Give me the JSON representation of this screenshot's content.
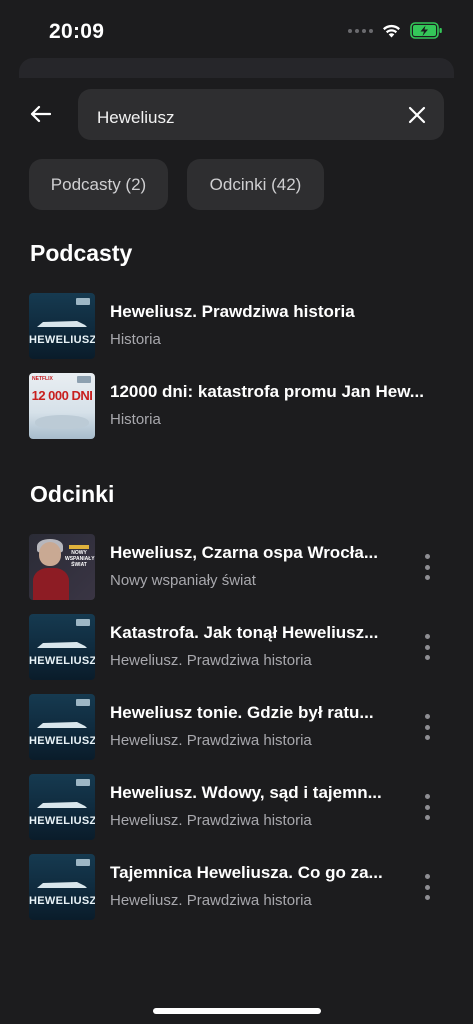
{
  "status_bar": {
    "time": "20:09"
  },
  "search": {
    "query": "Heweliusz"
  },
  "filters": {
    "podcasts_label": "Podcasty (2)",
    "episodes_label": "Odcinki (42)"
  },
  "sections": {
    "podcasts_title": "Podcasty",
    "episodes_title": "Odcinki"
  },
  "podcasts": [
    {
      "title": "Heweliusz. Prawdziwa historia",
      "category": "Historia"
    },
    {
      "title": "12000 dni: katastrofa promu Jan Hew...",
      "category": "Historia"
    }
  ],
  "episodes": [
    {
      "title": "Heweliusz, Czarna ospa Wrocła...",
      "podcast": "Nowy wspaniały świat"
    },
    {
      "title": "Katastrofa. Jak tonął Heweliusz...",
      "podcast": "Heweliusz. Prawdziwa historia"
    },
    {
      "title": "Heweliusz tonie. Gdzie był ratu...",
      "podcast": "Heweliusz. Prawdziwa historia"
    },
    {
      "title": "Heweliusz. Wdowy, sąd i tajemn...",
      "podcast": "Heweliusz. Prawdziwa historia"
    },
    {
      "title": "Tajemnica Heweliusza. Co go za...",
      "podcast": "Heweliusz. Prawdziwa historia"
    }
  ],
  "artwork": {
    "heweliusz_logo": "HEWELIUSZ",
    "netflix_label": "NETFLIX",
    "twelve_k_big": "12 000 DNI",
    "nws_title": "NOWY WSPANIAŁY ŚWIAT"
  },
  "colors": {
    "background": "#1c1c1e",
    "surface": "#2e2e30",
    "battery": "#34c759"
  }
}
